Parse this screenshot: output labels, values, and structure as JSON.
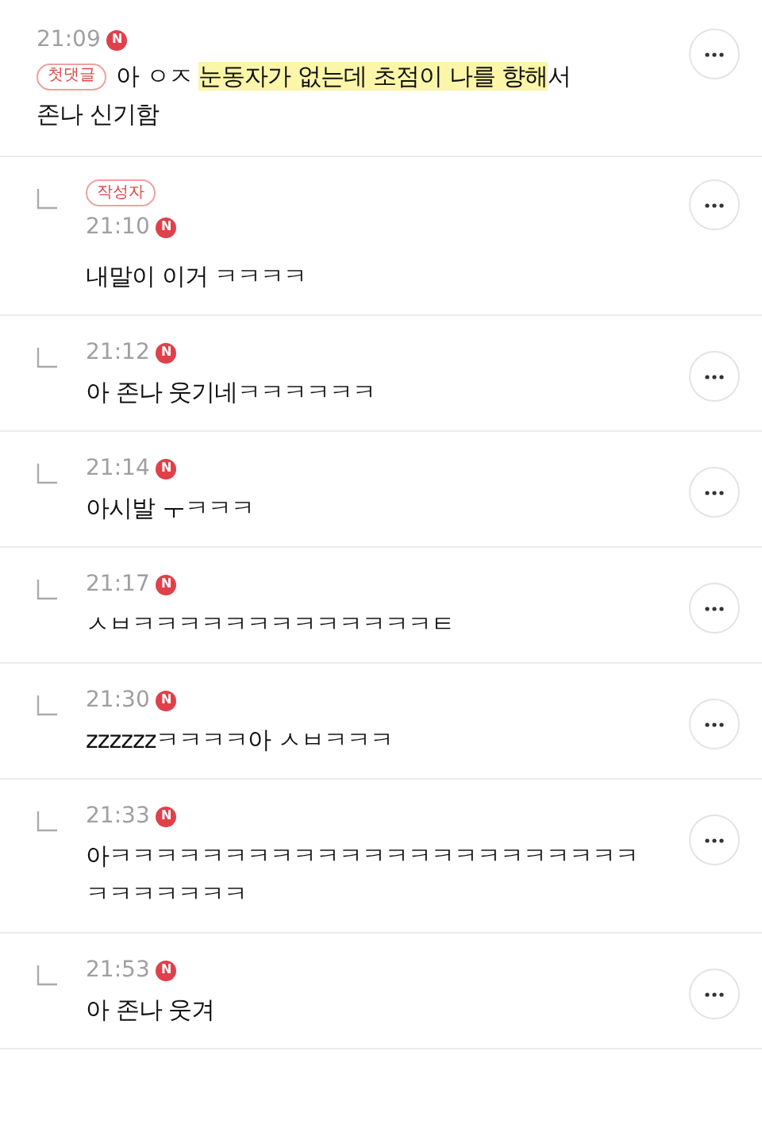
{
  "comments": [
    {
      "kind": "comment",
      "time": "21:09",
      "new_badge": "N",
      "badge": "첫댓글",
      "lines": [
        [
          {
            "text": "아 ㅇㅈ ",
            "highlighted": false
          },
          {
            "text": "눈동자가 없는데 초점이 나를 향해",
            "highlighted": true
          },
          {
            "text": "서",
            "highlighted": false
          }
        ],
        [
          {
            "text": "존나 신기함",
            "highlighted": false
          }
        ]
      ]
    },
    {
      "kind": "reply",
      "time": "21:10",
      "new_badge": "N",
      "badge": "작성자",
      "lines": [
        [
          {
            "text": "내말이 이거 ㅋㅋㅋㅋ",
            "highlighted": false
          }
        ]
      ]
    },
    {
      "kind": "reply",
      "time": "21:12",
      "new_badge": "N",
      "lines": [
        [
          {
            "text": "아 존나 웃기네ㅋㅋㅋㅋㅋㅋ",
            "highlighted": false
          }
        ]
      ]
    },
    {
      "kind": "reply",
      "time": "21:14",
      "new_badge": "N",
      "lines": [
        [
          {
            "text": "아시발 ㅜㅋㅋㅋ",
            "highlighted": false
          }
        ]
      ]
    },
    {
      "kind": "reply",
      "time": "21:17",
      "new_badge": "N",
      "lines": [
        [
          {
            "text": "ㅅㅂㅋㅋㅋㅋㅋㅋㅋㅋㅋㅋㅋㅋㅋㅌ",
            "highlighted": false
          }
        ]
      ]
    },
    {
      "kind": "reply",
      "time": "21:30",
      "new_badge": "N",
      "lines": [
        [
          {
            "text": "zzzzzzㅋㅋㅋㅋ아 ㅅㅂㅋㅋㅋ",
            "highlighted": false
          }
        ]
      ]
    },
    {
      "kind": "reply",
      "time": "21:33",
      "new_badge": "N",
      "lines": [
        [
          {
            "text": "아ㅋㅋㅋㅋㅋㅋㅋㅋㅋㅋㅋㅋㅋㅋㅋㅋㅋㅋㅋㅋㅋㅋㅋ",
            "highlighted": false
          }
        ],
        [
          {
            "text": "ㅋㅋㅋㅋㅋㅋㅋ",
            "highlighted": false
          }
        ]
      ]
    },
    {
      "kind": "reply",
      "time": "21:53",
      "new_badge": "N",
      "lines": [
        [
          {
            "text": "아 존나 웃겨",
            "highlighted": false
          }
        ]
      ]
    }
  ]
}
